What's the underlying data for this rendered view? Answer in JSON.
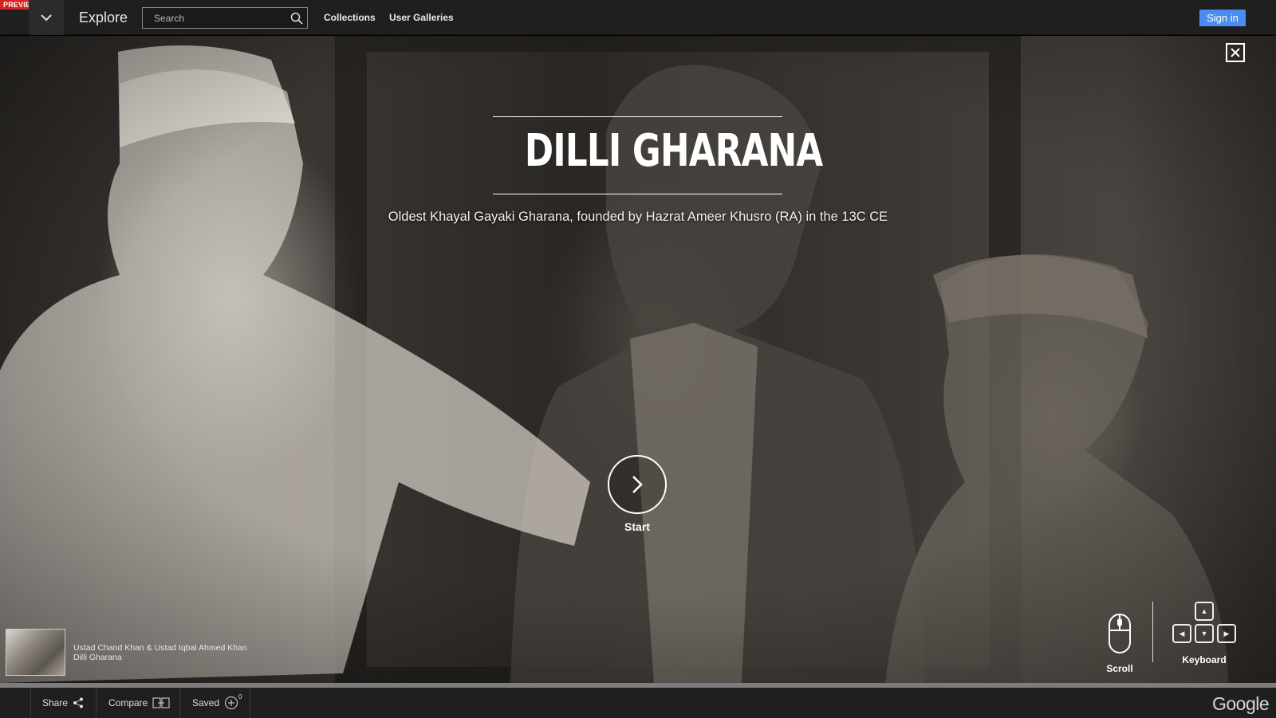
{
  "header": {
    "preview_badge": "PREVIEW",
    "menu_icon": "chevron-down-icon",
    "explore_label": "Explore",
    "search_placeholder": "Search",
    "nav": [
      "Collections",
      "User Galleries"
    ],
    "sign_in_label": "Sign in",
    "accent_color": "#4a8cf0"
  },
  "hero": {
    "title": "DILLI GHARANA",
    "subtitle": "Oldest Khayal Gayaki Gharana, founded by Hazrat Ameer Khusro (RA) in the 13C CE",
    "start_label": "Start",
    "caption_line1": "Ustad Chand Khan & Ustad Iqbal Ahmed Khan",
    "caption_line2": "Dilli Gharana",
    "scroll_label": "Scroll",
    "keyboard_label": "Keyboard"
  },
  "footer": {
    "share_label": "Share",
    "compare_label": "Compare",
    "saved_label": "Saved",
    "saved_count": "0",
    "brand": "Google"
  }
}
